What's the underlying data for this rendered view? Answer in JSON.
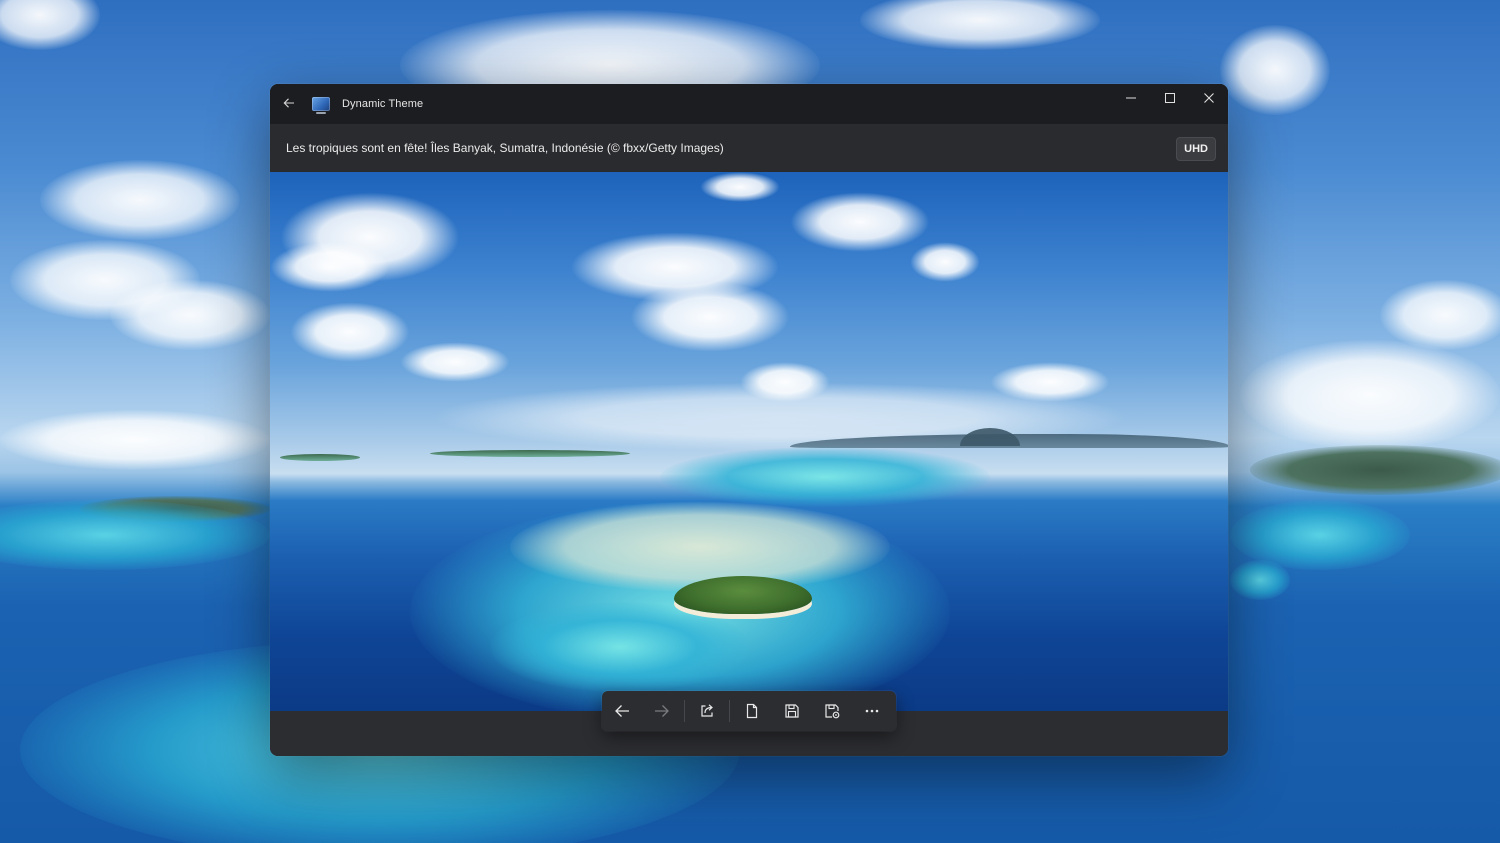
{
  "window": {
    "title": "Dynamic Theme",
    "controls": {
      "minimize": "minimize-icon",
      "maximize": "maximize-icon",
      "close": "close-icon"
    }
  },
  "caption": {
    "text": "Les tropiques sont en fête! Îles Banyak, Sumatra, Indonésie (© fbxx/Getty Images)",
    "badge": "UHD"
  },
  "toolbar": {
    "buttons": [
      {
        "icon": "arrow-left-icon",
        "state": "enabled"
      },
      {
        "icon": "arrow-right-icon",
        "state": "disabled"
      },
      {
        "icon": "share-icon",
        "state": "enabled"
      },
      {
        "icon": "file-icon",
        "state": "enabled"
      },
      {
        "icon": "save-icon",
        "state": "enabled"
      },
      {
        "icon": "save-settings-icon",
        "state": "enabled"
      },
      {
        "icon": "more-icon",
        "state": "enabled"
      }
    ]
  },
  "colors": {
    "titlebar": "#1c1d20",
    "captionbar": "#2a2b2e",
    "toolbar": "#2c2d31",
    "text": "#ebebeb"
  }
}
